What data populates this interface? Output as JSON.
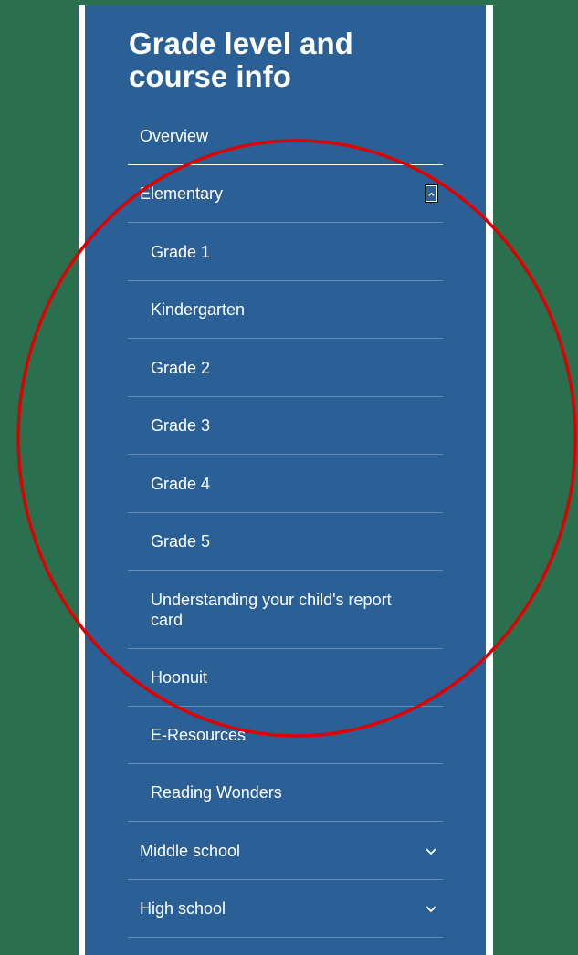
{
  "title": "Grade level and course info",
  "nav": {
    "overview": "Overview",
    "elementary": {
      "label": "Elementary",
      "toggle_icon": "chevron-up-icon",
      "items": [
        "Grade 1",
        "Kindergarten",
        "Grade 2",
        "Grade 3",
        "Grade 4",
        "Grade 5",
        "Understanding your child's report card",
        "Hoonuit",
        "E-Resources",
        "Reading Wonders"
      ]
    },
    "middle_school": {
      "label": "Middle school",
      "icon": "chevron-down-icon"
    },
    "high_school": {
      "label": "High school",
      "icon": "chevron-down-icon"
    }
  },
  "colors": {
    "background": "#2a704f",
    "panel": "#2a6096",
    "text": "#ffffff",
    "annotation_circle": "#e00000"
  }
}
